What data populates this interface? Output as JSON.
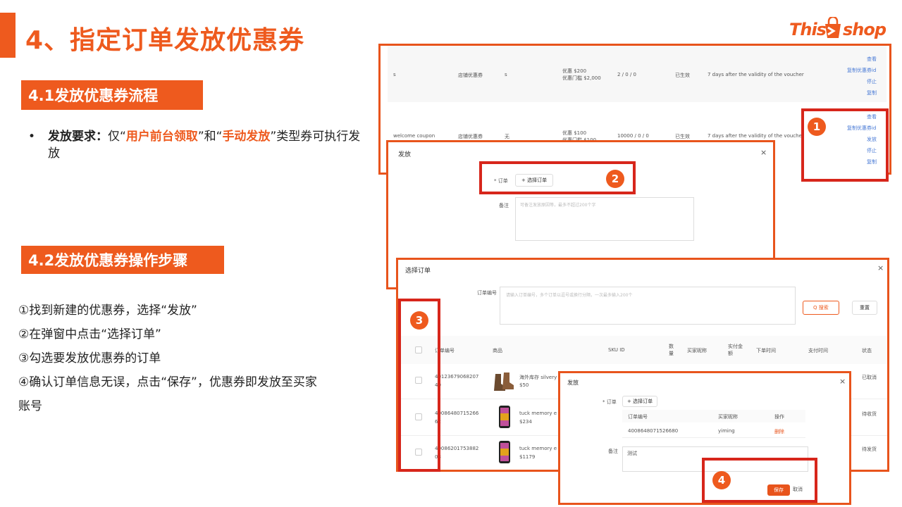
{
  "page": {
    "title": "4、指定订单发放优惠券",
    "logo": {
      "left": "This",
      "right": "shop"
    }
  },
  "section1": {
    "heading": "4.1发放优惠券流程",
    "bullet_label": "发放要求：",
    "bullet_p1": "仅“",
    "bullet_h1": "用户前台领取",
    "bullet_p2": "”和“",
    "bullet_h2": "手动发放",
    "bullet_p3": "”类型券可执行发放"
  },
  "section2": {
    "heading": "4.2发放优惠券操作步骤",
    "steps": [
      "①找到新建的优惠券，选择“发放”",
      "②在弹窗中点击“选择订单”",
      "③勾选要发放优惠券的订单",
      "④确认订单信息无误，点击“保存”，优惠券即发放至买家",
      "账号"
    ]
  },
  "coupon_table": {
    "rows": [
      {
        "name": "s",
        "type": "店铺优惠券",
        "range": "s",
        "rule1": "优惠 $200",
        "rule2": "优惠门槛 $2,000",
        "count": "2 / 0 / 0",
        "status": "已生效",
        "validity": "7 days after the validity of the voucher",
        "actions": [
          "查看",
          "复制优惠券id",
          "停止",
          "复制"
        ]
      },
      {
        "name": "welcome coupon",
        "type": "店铺优惠券",
        "range": "无",
        "rule1": "优惠 $100",
        "rule2": "优惠门槛 $100",
        "count": "10000 / 0 / 0",
        "status": "已生效",
        "validity": "7 days after the validity of the voucher",
        "actions": [
          "查看",
          "复制优惠券id",
          "发放",
          "停止",
          "复制"
        ]
      }
    ]
  },
  "issue_dialog": {
    "title": "发放",
    "order_label": "* 订单",
    "select_btn": "+ 选择订单",
    "remark_label": "备注",
    "remark_placeholder": "可备注发放原因等，最多不超过200个字"
  },
  "select_dialog": {
    "title": "选择订单",
    "order_no_label": "订单编号",
    "order_no_placeholder": "请输入订单编号，多个订单以逗号或换行分隔，一次最多输入200个",
    "search_btn": "Q 搜索",
    "reset_btn": "重置",
    "columns": [
      "订单编号",
      "商品",
      "SKU ID",
      "数量",
      "买家昵称",
      "实付金额",
      "下单时间",
      "支付时间",
      "状态"
    ],
    "rows": [
      {
        "order": "4012367906820734",
        "order_tail": "40",
        "product": "海外库存 silvery",
        "price": "$50",
        "status": "已取消",
        "status2": "消"
      },
      {
        "order": "4008648071526680",
        "order_tail": "62",
        "product": "tuck memory e y",
        "price": "$234",
        "status": "待收货",
        "status2": "货"
      },
      {
        "order": "4008620175388270",
        "order_tail": "03",
        "product": "tuck memory e y",
        "price": "$1179",
        "status": "待发货",
        "status2": "货"
      }
    ]
  },
  "confirm_dialog": {
    "title": "发放",
    "order_label": "* 订单",
    "select_btn": "+ 选择订单",
    "columns": [
      "订单编号",
      "买家昵称",
      "操作"
    ],
    "row": {
      "order": "4008648071526680",
      "buyer": "yiming",
      "op": "删除"
    },
    "remark_label": "备注",
    "remark_value": "测试",
    "save_btn": "保存",
    "cancel_btn": "取消"
  },
  "badges": [
    "1",
    "2",
    "3",
    "4"
  ],
  "colors": {
    "accent": "#ee5a1e",
    "highlight_box": "#d7261b",
    "link": "#4a7bd6"
  }
}
